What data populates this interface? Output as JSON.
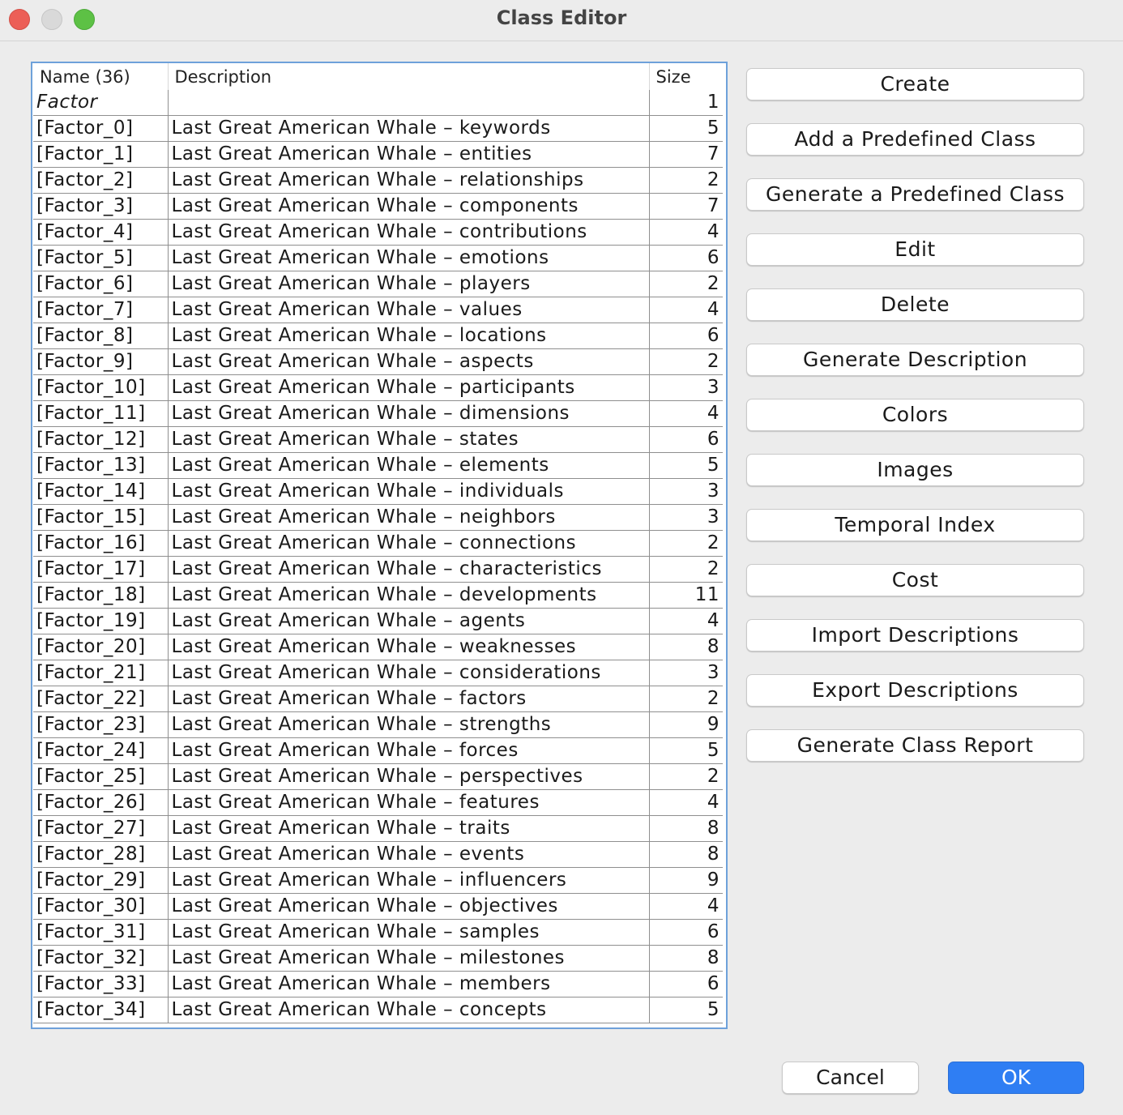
{
  "window": {
    "title": "Class Editor"
  },
  "table": {
    "headers": {
      "name": "Name (36)",
      "description": "Description",
      "size": "Size"
    },
    "rows": [
      {
        "name": "Factor",
        "description": "",
        "size": "1"
      },
      {
        "name": "[Factor_0]",
        "description": "Last Great American Whale – keywords",
        "size": "5"
      },
      {
        "name": "[Factor_1]",
        "description": "Last Great American Whale – entities",
        "size": "7"
      },
      {
        "name": "[Factor_2]",
        "description": "Last Great American Whale – relationships",
        "size": "2"
      },
      {
        "name": "[Factor_3]",
        "description": "Last Great American Whale – components",
        "size": "7"
      },
      {
        "name": "[Factor_4]",
        "description": "Last Great American Whale – contributions",
        "size": "4"
      },
      {
        "name": "[Factor_5]",
        "description": "Last Great American Whale – emotions",
        "size": "6"
      },
      {
        "name": "[Factor_6]",
        "description": "Last Great American Whale – players",
        "size": "2"
      },
      {
        "name": "[Factor_7]",
        "description": "Last Great American Whale – values",
        "size": "4"
      },
      {
        "name": "[Factor_8]",
        "description": "Last Great American Whale – locations",
        "size": "6"
      },
      {
        "name": "[Factor_9]",
        "description": "Last Great American Whale – aspects",
        "size": "2"
      },
      {
        "name": "[Factor_10]",
        "description": "Last Great American Whale – participants",
        "size": "3"
      },
      {
        "name": "[Factor_11]",
        "description": "Last Great American Whale – dimensions",
        "size": "4"
      },
      {
        "name": "[Factor_12]",
        "description": "Last Great American Whale – states",
        "size": "6"
      },
      {
        "name": "[Factor_13]",
        "description": "Last Great American Whale – elements",
        "size": "5"
      },
      {
        "name": "[Factor_14]",
        "description": "Last Great American Whale – individuals",
        "size": "3"
      },
      {
        "name": "[Factor_15]",
        "description": "Last Great American Whale – neighbors",
        "size": "3"
      },
      {
        "name": "[Factor_16]",
        "description": "Last Great American Whale – connections",
        "size": "2"
      },
      {
        "name": "[Factor_17]",
        "description": "Last Great American Whale – characteristics",
        "size": "2"
      },
      {
        "name": "[Factor_18]",
        "description": "Last Great American Whale – developments",
        "size": "11"
      },
      {
        "name": "[Factor_19]",
        "description": "Last Great American Whale – agents",
        "size": "4"
      },
      {
        "name": "[Factor_20]",
        "description": "Last Great American Whale – weaknesses",
        "size": "8"
      },
      {
        "name": "[Factor_21]",
        "description": "Last Great American Whale – considerations",
        "size": "3"
      },
      {
        "name": "[Factor_22]",
        "description": "Last Great American Whale – factors",
        "size": "2"
      },
      {
        "name": "[Factor_23]",
        "description": "Last Great American Whale – strengths",
        "size": "9"
      },
      {
        "name": "[Factor_24]",
        "description": "Last Great American Whale – forces",
        "size": "5"
      },
      {
        "name": "[Factor_25]",
        "description": "Last Great American Whale – perspectives",
        "size": "2"
      },
      {
        "name": "[Factor_26]",
        "description": "Last Great American Whale – features",
        "size": "4"
      },
      {
        "name": "[Factor_27]",
        "description": "Last Great American Whale – traits",
        "size": "8"
      },
      {
        "name": "[Factor_28]",
        "description": "Last Great American Whale – events",
        "size": "8"
      },
      {
        "name": "[Factor_29]",
        "description": "Last Great American Whale – influencers",
        "size": "9"
      },
      {
        "name": "[Factor_30]",
        "description": "Last Great American Whale – objectives",
        "size": "4"
      },
      {
        "name": "[Factor_31]",
        "description": "Last Great American Whale – samples",
        "size": "6"
      },
      {
        "name": "[Factor_32]",
        "description": "Last Great American Whale – milestones",
        "size": "8"
      },
      {
        "name": "[Factor_33]",
        "description": "Last Great American Whale – members",
        "size": "6"
      },
      {
        "name": "[Factor_34]",
        "description": "Last Great American Whale – concepts",
        "size": "5"
      }
    ]
  },
  "actions": [
    {
      "id": "create",
      "label": "Create"
    },
    {
      "id": "add-predefined-class",
      "label": "Add a Predefined Class"
    },
    {
      "id": "generate-predefined-class",
      "label": "Generate a Predefined Class"
    },
    {
      "id": "edit",
      "label": "Edit"
    },
    {
      "id": "delete",
      "label": "Delete"
    },
    {
      "id": "generate-description",
      "label": "Generate Description"
    },
    {
      "id": "colors",
      "label": "Colors"
    },
    {
      "id": "images",
      "label": "Images"
    },
    {
      "id": "temporal-index",
      "label": "Temporal Index"
    },
    {
      "id": "cost",
      "label": "Cost"
    },
    {
      "id": "import-descriptions",
      "label": "Import Descriptions"
    },
    {
      "id": "export-descriptions",
      "label": "Export Descriptions"
    },
    {
      "id": "generate-class-report",
      "label": "Generate Class Report"
    }
  ],
  "footer": {
    "cancel_label": "Cancel",
    "ok_label": "OK"
  },
  "colors": {
    "accent": "#2f7ef3",
    "selection_border": "#6ea1da",
    "close": "#ec5f57",
    "maximize": "#5dc145"
  }
}
